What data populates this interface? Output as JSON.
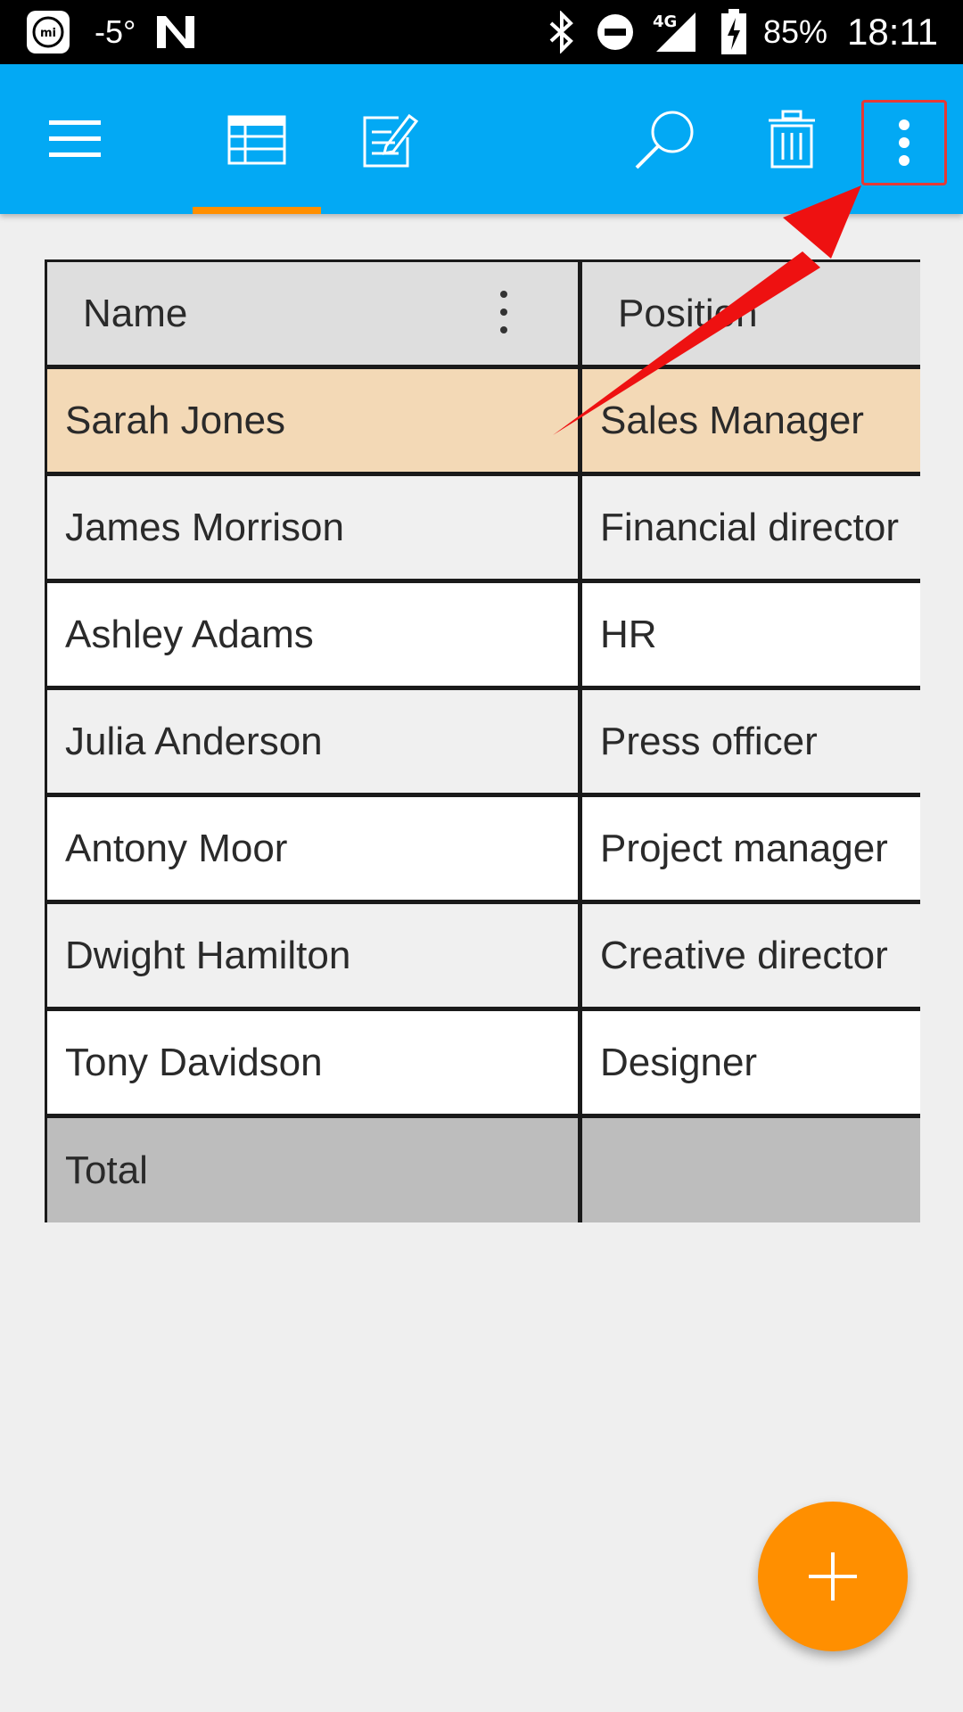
{
  "status_bar": {
    "temperature": "-5°",
    "network": "4G",
    "battery": "85%",
    "time": "18:11",
    "icons": [
      "mi-icon",
      "n-icon",
      "bluetooth-icon",
      "dnd-icon",
      "signal-icon",
      "battery-charging-icon"
    ]
  },
  "toolbar": {
    "menu_icon": "hamburger-icon",
    "tab_table_icon": "table-icon",
    "tab_form_icon": "edit-form-icon",
    "search_icon": "search-icon",
    "delete_icon": "trash-icon",
    "more_icon": "more-vert-icon",
    "active_tab": "table",
    "colors": {
      "bar": "#03a9f4",
      "indicator": "#ff8f00",
      "highlight": "#e53935"
    }
  },
  "table": {
    "columns": [
      "Name",
      "Position"
    ],
    "rows": [
      {
        "name": "Sarah Jones",
        "position": "Sales Manager",
        "selected": true
      },
      {
        "name": "James Morrison",
        "position": "Financial director"
      },
      {
        "name": "Ashley Adams",
        "position": "HR"
      },
      {
        "name": "Julia Anderson",
        "position": "Press officer"
      },
      {
        "name": "Antony Moor",
        "position": "Project manager"
      },
      {
        "name": "Dwight Hamilton",
        "position": "Creative director"
      },
      {
        "name": "Tony Davidson",
        "position": "Designer"
      }
    ],
    "total_label": "Total",
    "total_value": "",
    "colors": {
      "selected_row": "#f3d9b6",
      "header": "#dedede",
      "total": "#bdbdbd"
    }
  },
  "fab": {
    "icon": "plus-icon",
    "color": "#ff8f00"
  }
}
